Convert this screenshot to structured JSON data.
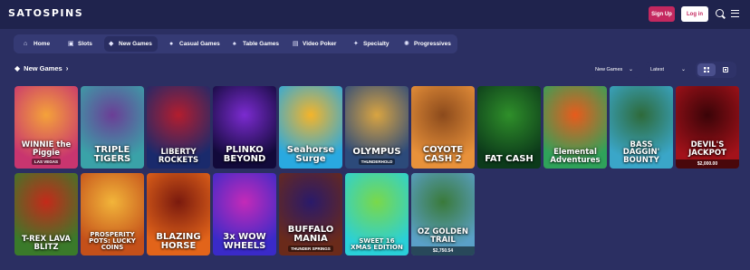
{
  "header": {
    "logo": "SATOSPINS",
    "signup_label": "Sign Up",
    "login_label": "Log in"
  },
  "categories": [
    {
      "label": "Home",
      "icon": "home-icon",
      "active": false
    },
    {
      "label": "Slots",
      "icon": "slot-machine-icon",
      "active": false
    },
    {
      "label": "New Games",
      "icon": "diamond-icon",
      "active": true
    },
    {
      "label": "Casual Games",
      "icon": "gamepad-icon",
      "active": false
    },
    {
      "label": "Table Games",
      "icon": "cards-icon",
      "active": false
    },
    {
      "label": "Video Poker",
      "icon": "poker-chip-icon",
      "active": false
    },
    {
      "label": "Specialty",
      "icon": "specialty-icon",
      "active": false
    },
    {
      "label": "Progressives",
      "icon": "progressive-icon",
      "active": false
    }
  ],
  "section": {
    "title": "New Games",
    "filter_value": "New Games",
    "sort_value": "Latest"
  },
  "games": [
    {
      "title": "WINNIE the Piggie",
      "sub": "LAS VEGAS",
      "bg": "#c8356f",
      "bg2": "#f4a23a",
      "jackpot": ""
    },
    {
      "title": "TRIPLE TIGERS",
      "sub": "",
      "bg": "#3aa2a8",
      "bg2": "#6b3e96",
      "jackpot": ""
    },
    {
      "title": "LIBERTY ROCKETS",
      "sub": "",
      "bg": "#1a2a6c",
      "bg2": "#b31d2e",
      "jackpot": ""
    },
    {
      "title": "PLINKO BEYOND",
      "sub": "",
      "bg": "#120a3a",
      "bg2": "#7b2bd0",
      "jackpot": ""
    },
    {
      "title": "Seahorse Surge",
      "sub": "",
      "bg": "#29a9e0",
      "bg2": "#f4b42a",
      "jackpot": ""
    },
    {
      "title": "OLYMPUS",
      "sub": "THUNDERHOLD",
      "bg": "#2c4a7a",
      "bg2": "#d9a441",
      "jackpot": ""
    },
    {
      "title": "COYOTE CASH 2",
      "sub": "",
      "bg": "#e8913a",
      "bg2": "#8b4a1c",
      "jackpot": ""
    },
    {
      "title": "FAT CASH",
      "sub": "",
      "bg": "#0c3a1a",
      "bg2": "#2f8f2a",
      "jackpot": ""
    },
    {
      "title": "Elemental Adventures",
      "sub": "",
      "bg": "#2fa25a",
      "bg2": "#e85b1c",
      "jackpot": ""
    },
    {
      "title": "BASS DAGGIN' BOUNTY",
      "sub": "",
      "bg": "#3aa6c8",
      "bg2": "#2e6a3a",
      "jackpot": ""
    },
    {
      "title": "DEVIL'S JACKPOT",
      "sub": "",
      "bg": "#a3121a",
      "bg2": "#3a0408",
      "jackpot": "$2,000.00"
    },
    {
      "title": "T-REX LAVA BLITZ",
      "sub": "",
      "bg": "#3a7a2a",
      "bg2": "#c42a1a",
      "jackpot": ""
    },
    {
      "title": "PROSPERITY POTS: LUCKY COINS",
      "sub": "",
      "bg": "#c4501a",
      "bg2": "#f2b53a",
      "jackpot": ""
    },
    {
      "title": "BLAZING HORSE",
      "sub": "",
      "bg": "#e2641a",
      "bg2": "#7a1a0e",
      "jackpot": ""
    },
    {
      "title": "3x WOW WHEELS",
      "sub": "",
      "bg": "#3a2ac8",
      "bg2": "#c42ab8",
      "jackpot": ""
    },
    {
      "title": "BUFFALO MANIA",
      "sub": "THUNDER SPRINGS",
      "bg": "#6a2a1a",
      "bg2": "#2a1a6a",
      "jackpot": ""
    },
    {
      "title": "SWEET 16 XMAS EDITION",
      "sub": "",
      "bg": "#2ad0d8",
      "bg2": "#7ad84a",
      "jackpot": ""
    },
    {
      "title": "OZ GOLDEN TRAIL",
      "sub": "",
      "bg": "#5aa0c8",
      "bg2": "#3a7a3a",
      "jackpot": "$2,750.54"
    }
  ]
}
